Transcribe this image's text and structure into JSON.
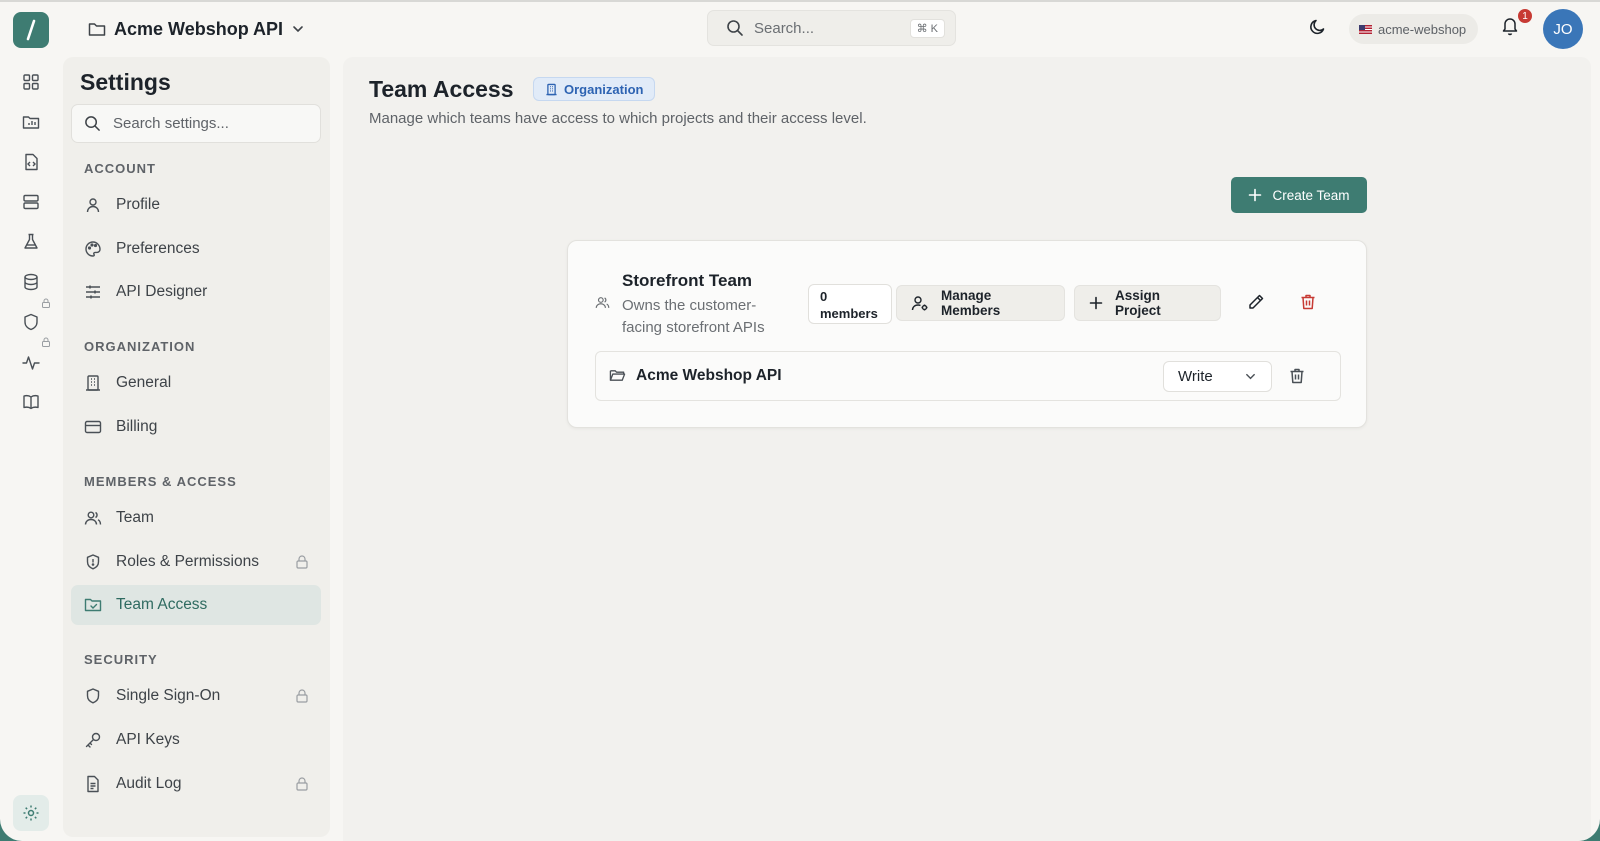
{
  "topbar": {
    "project_name": "Acme Webshop API",
    "search_placeholder": "Search...",
    "search_shortcut": "⌘ K",
    "workspace": "acme-webshop",
    "notification_count": "1",
    "avatar_initials": "JO"
  },
  "settings": {
    "title": "Settings",
    "search_placeholder": "Search settings...",
    "sections": {
      "account": {
        "label": "ACCOUNT",
        "items": [
          "Profile",
          "Preferences",
          "API Designer"
        ]
      },
      "organization": {
        "label": "ORGANIZATION",
        "items": [
          "General",
          "Billing"
        ]
      },
      "members": {
        "label": "MEMBERS & ACCESS",
        "items": [
          "Team",
          "Roles & Permissions",
          "Team Access"
        ]
      },
      "security": {
        "label": "SECURITY",
        "items": [
          "Single Sign-On",
          "API Keys",
          "Audit Log"
        ]
      }
    },
    "active_item": "Team Access"
  },
  "main": {
    "title": "Team Access",
    "badge": "Organization",
    "description": "Manage which teams have access to which projects and their access level.",
    "create_button": "Create Team",
    "team": {
      "name": "Storefront Team",
      "description": "Owns the customer-facing storefront APIs",
      "member_count": "0",
      "member_label": "members",
      "manage_button": "Manage Members",
      "assign_button": "Assign Project",
      "projects": [
        {
          "name": "Acme Webshop API",
          "access": "Write"
        }
      ]
    }
  },
  "colors": {
    "accent": "#3e7c72",
    "badge_blue": "#2d63b2",
    "danger": "#c73a33"
  }
}
